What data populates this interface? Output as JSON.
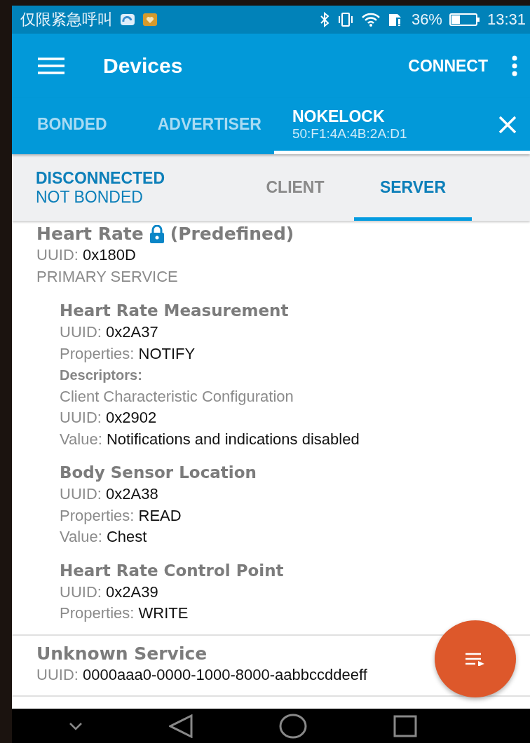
{
  "status_bar": {
    "carrier_text": "仅限紧急呼叫",
    "battery_text": "36%",
    "time": "13:31"
  },
  "app_bar": {
    "title": "Devices",
    "action": "CONNECT"
  },
  "device_tabs": [
    {
      "label": "BONDED",
      "selected": false
    },
    {
      "label": "ADVERTISER",
      "selected": false
    },
    {
      "label": "NOKELOCK",
      "address": "50:F1:4A:4B:2A:D1",
      "selected": true
    }
  ],
  "connection": {
    "state": "DISCONNECTED",
    "bond": "NOT BONDED"
  },
  "sub_tabs": [
    {
      "label": "CLIENT",
      "selected": false
    },
    {
      "label": "SERVER",
      "selected": true
    }
  ],
  "services": [
    {
      "name": "Heart Rate",
      "locked": true,
      "note": "(Predefined)",
      "fields": [
        {
          "label": "UUID:",
          "value": "0x180D"
        }
      ],
      "type": "PRIMARY SERVICE",
      "characteristics": [
        {
          "name": "Heart Rate Measurement",
          "fields": [
            {
              "label": "UUID:",
              "value": "0x2A37"
            },
            {
              "label": "Properties:",
              "value": "NOTIFY"
            }
          ],
          "descriptors_label": "Descriptors:",
          "descriptors": [
            {
              "name": "Client Characteristic Configuration",
              "fields": [
                {
                  "label": "UUID:",
                  "value": "0x2902"
                },
                {
                  "label": "Value:",
                  "value": "Notifications and indications disabled"
                }
              ]
            }
          ]
        },
        {
          "name": "Body Sensor Location",
          "fields": [
            {
              "label": "UUID:",
              "value": "0x2A38"
            },
            {
              "label": "Properties:",
              "value": "READ"
            },
            {
              "label": "Value:",
              "value": "Chest"
            }
          ]
        },
        {
          "name": "Heart Rate Control Point",
          "fields": [
            {
              "label": "UUID:",
              "value": "0x2A39"
            },
            {
              "label": "Properties:",
              "value": "WRITE"
            }
          ]
        }
      ]
    },
    {
      "name": "Unknown Service",
      "locked": false,
      "fields": [
        {
          "label": "UUID:",
          "value": "0000aaa0-0000-1000-8000-aabbccddeeff"
        }
      ]
    }
  ]
}
